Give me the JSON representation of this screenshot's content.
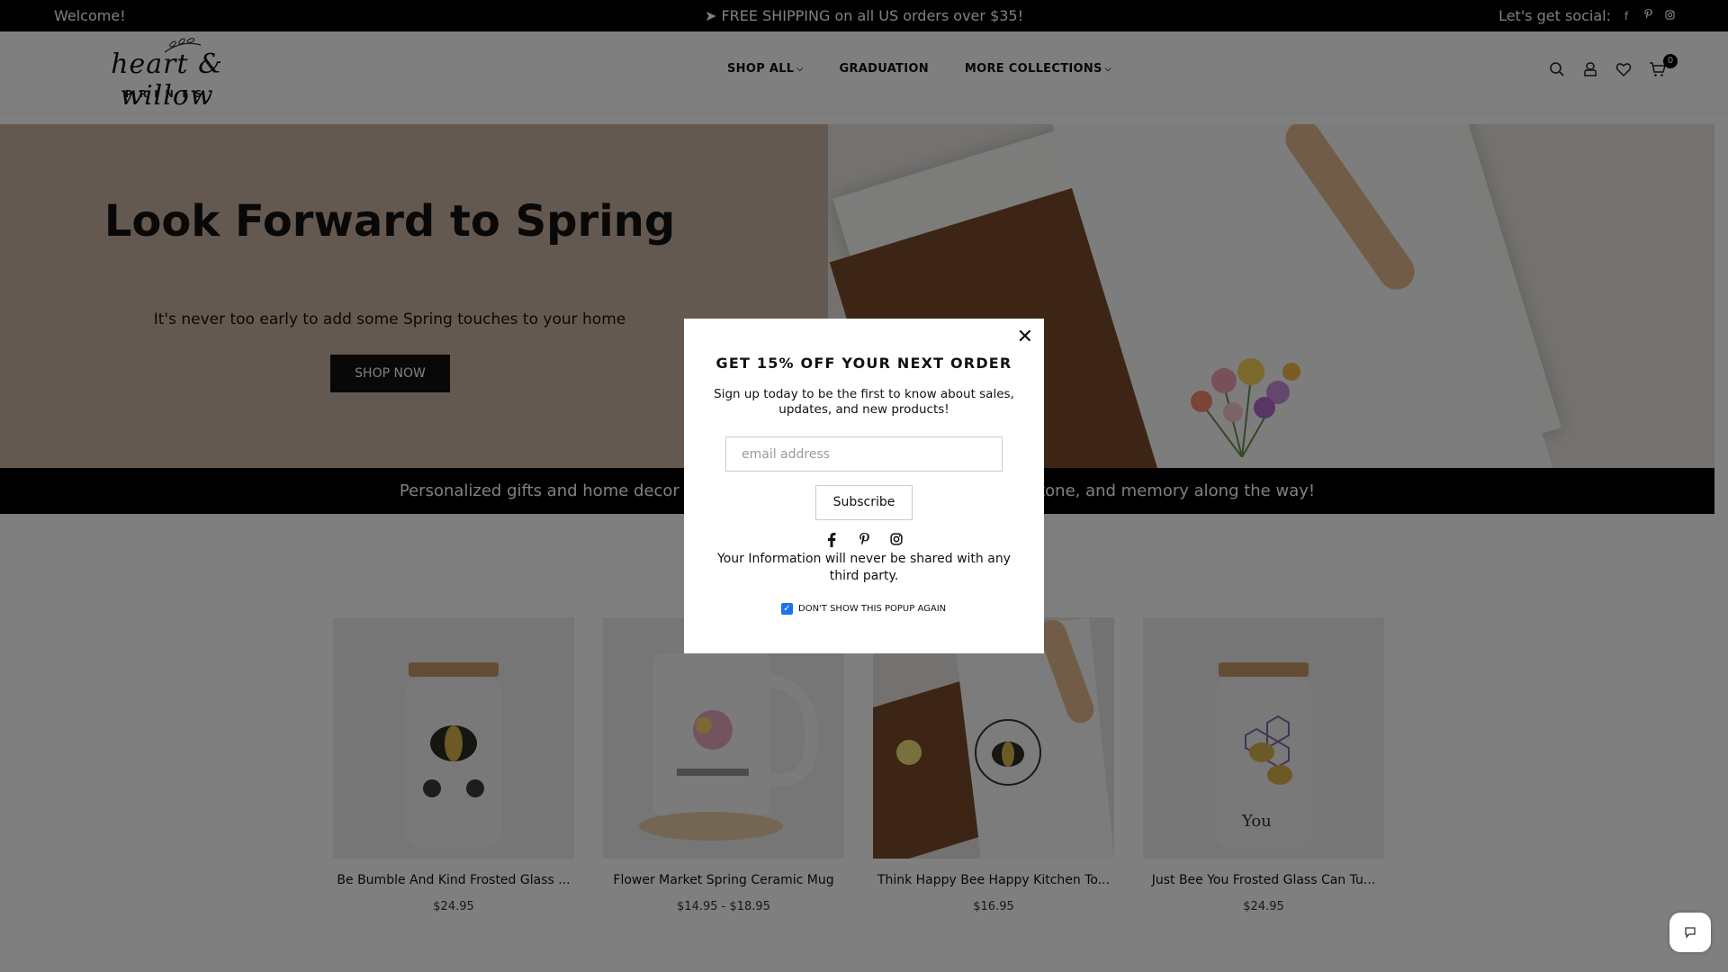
{
  "topbar": {
    "welcome": "Welcome!",
    "shipping": "➤ FREE SHIPPING on all US orders over $35!",
    "social_label": "Let's get social:",
    "social_icons": [
      "facebook-icon",
      "pinterest-icon",
      "instagram-icon"
    ]
  },
  "header": {
    "logo_script": "heart & willow",
    "logo_sub": "PRINTS",
    "nav": [
      {
        "label": "SHOP ALL",
        "has_dropdown": true
      },
      {
        "label": "GRADUATION",
        "has_dropdown": false
      },
      {
        "label": "MORE COLLECTIONS",
        "has_dropdown": true
      }
    ],
    "cart_count": "0"
  },
  "hero": {
    "title": "Look Forward to Spring",
    "subtitle": "It's never too early to add some Spring touches to your home",
    "button": "SHOP NOW"
  },
  "band": {
    "text": "Personalized gifts and home decor with love to celebrate every moment, milestone, and memory along the way!"
  },
  "products": [
    {
      "name": "Be Bumble And Kind Frosted Glass ...",
      "price": "$24.95"
    },
    {
      "name": "Flower Market Spring Ceramic Mug",
      "price": "$14.95 - $18.95"
    },
    {
      "name": "Think Happy Bee Happy Kitchen To...",
      "price": "$16.95"
    },
    {
      "name": "Just Bee You Frosted Glass Can Tu...",
      "price": "$24.95"
    }
  ],
  "popup": {
    "title": "GET 15% OFF YOUR NEXT ORDER",
    "description": "Sign up today to be the first to know about sales, updates, and new products!",
    "email_placeholder": "email address",
    "subscribe": "Subscribe",
    "note": "Your Information will never be shared with any third party.",
    "checkbox_label": "DON'T SHOW THIS POPUP AGAIN",
    "checkbox_checked": true,
    "close_glyph": "✕"
  },
  "colors": {
    "hero_bg": "#c8b3a0",
    "band_bg": "#000000",
    "checkbox": "#1a73e8"
  }
}
